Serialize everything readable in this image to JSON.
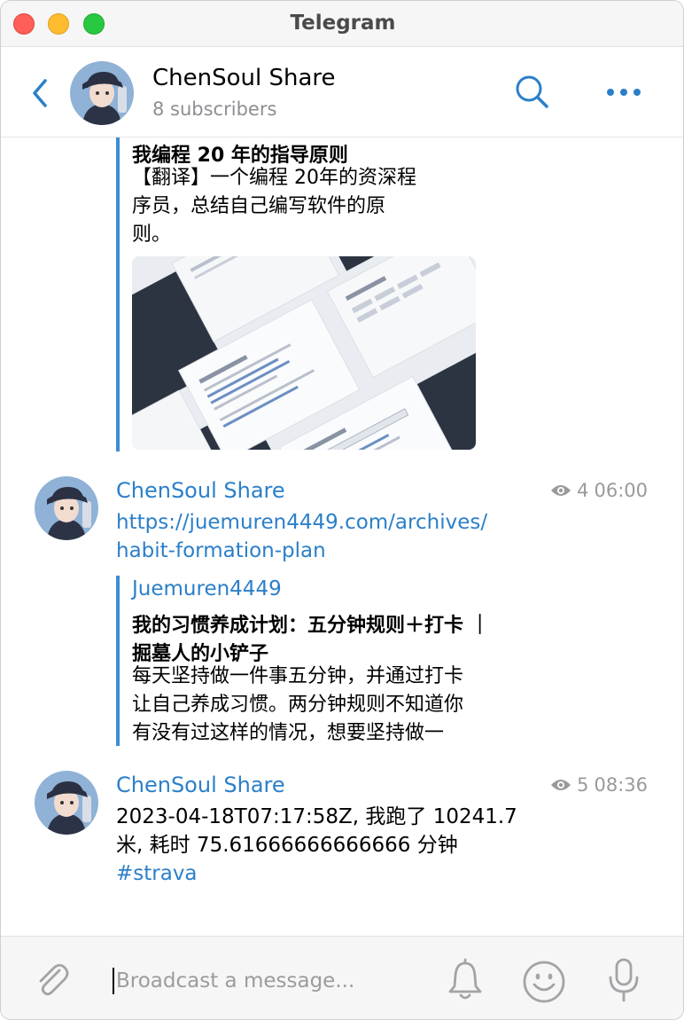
{
  "window": {
    "title": "Telegram"
  },
  "header": {
    "channel_name": "ChenSoul Share",
    "subscribers": "8 subscribers",
    "icons": [
      "back-chevron-icon",
      "search-icon",
      "more-dots-icon"
    ]
  },
  "messages": [
    {
      "quote_title": "我编程 20 年的指导原则",
      "quote_lines": [
        "【翻译】一个编程 20年的资深程",
        "序员，总结自己编写软件的原",
        "则。"
      ],
      "has_preview_image": true
    },
    {
      "author": "ChenSoul Share",
      "views": "4",
      "time": "06:00",
      "text_lines": [
        "https://juemuren4449.com/archives/",
        "habit-formation-plan"
      ],
      "quote_site": "Juemuren4449",
      "quote_title_lines": [
        "我的习惯养成计划：五分钟规则＋打卡 ｜",
        "掘墓人的小铲子"
      ],
      "quote_lines": [
        "每天坚持做一件事五分钟，并通过打卡",
        "让自己养成习惯。两分钟规则不知道你",
        "有没有过这样的情况，想要坚持做一"
      ]
    },
    {
      "author": "ChenSoul Share",
      "views": "5",
      "time": "08:36",
      "text_lines": [
        "2023-04-18T07:17:58Z, 我跑了 10241.7",
        "米, 耗时 75.61666666666666 分钟"
      ],
      "hashtag": "#strava"
    }
  ],
  "composer": {
    "placeholder": "Broadcast a message...",
    "icons": [
      "paperclip-icon",
      "bell-icon",
      "emoji-icon",
      "microphone-icon"
    ]
  },
  "colors": {
    "accent": "#2b7fc9",
    "quote_bar": "#3a8ed6",
    "muted": "#8e8e93",
    "traffic_close": "#fe5f57",
    "traffic_min": "#febc2e",
    "traffic_max": "#28c840"
  }
}
